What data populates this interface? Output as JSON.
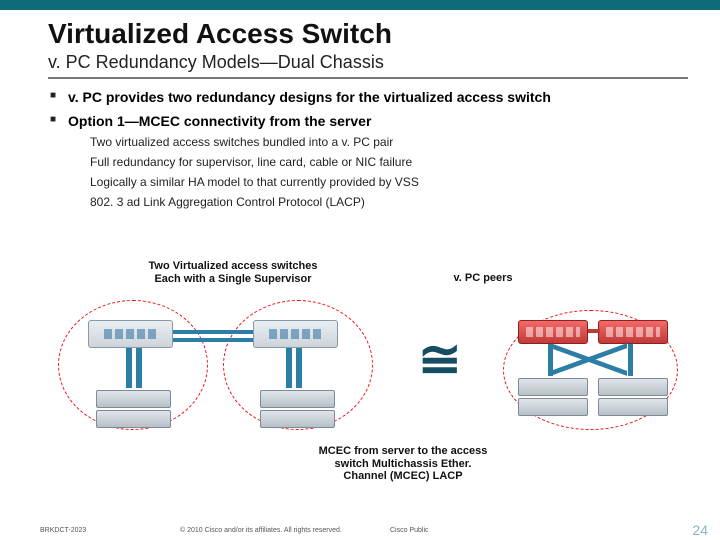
{
  "header": {
    "title": "Virtualized Access Switch",
    "subtitle": "v. PC Redundancy Models—Dual Chassis"
  },
  "bullets": [
    {
      "text": "v. PC provides two redundancy designs for the virtualized access switch",
      "sub": []
    },
    {
      "text": "Option 1—MCEC connectivity from the server",
      "sub": [
        "Two virtualized access switches bundled into a v. PC pair",
        "Full redundancy for supervisor, line card, cable or NIC failure",
        "Logically a similar HA model to that currently provided by VSS",
        "802. 3 ad Link Aggregation Control Protocol (LACP)"
      ]
    }
  ],
  "diagram": {
    "annot_left": "Two Virtualized access switches  Each with a Single Supervisor",
    "annot_right": "v. PC peers",
    "annot_bottom": "MCEC from server to the access switch Multichassis Ether. Channel (MCEC) LACP",
    "approx_symbol": "≅"
  },
  "footer": {
    "session": "BRKDCT-2023",
    "copyright": "© 2010 Cisco and/or its affiliates. All rights reserved.",
    "cisco": "Cisco Public",
    "page": "24"
  }
}
